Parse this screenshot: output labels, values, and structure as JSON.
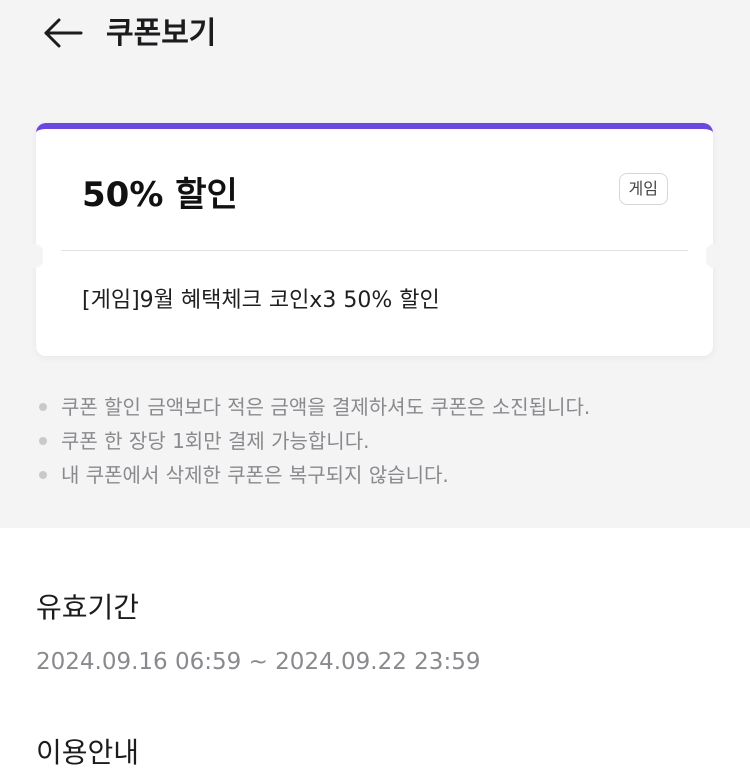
{
  "header": {
    "title": "쿠폰보기",
    "back_icon": "arrow-left-icon"
  },
  "coupon": {
    "discount_title": "50% 할인",
    "category_badge": "게임",
    "description": "[게임]9월 혜택체크 코인x3 50% 할인",
    "accent_color": "#6b46e0"
  },
  "notices": [
    "쿠폰 할인 금액보다 적은 금액을 결제하셔도 쿠폰은 소진됩니다.",
    "쿠폰 한 장당 1회만 결제 가능합니다.",
    "내 쿠폰에서 삭제한 쿠폰은 복구되지 않습니다."
  ],
  "validity": {
    "title": "유효기간",
    "range": "2024.09.16 06:59 ~ 2024.09.22 23:59"
  },
  "usage": {
    "title": "이용안내"
  }
}
